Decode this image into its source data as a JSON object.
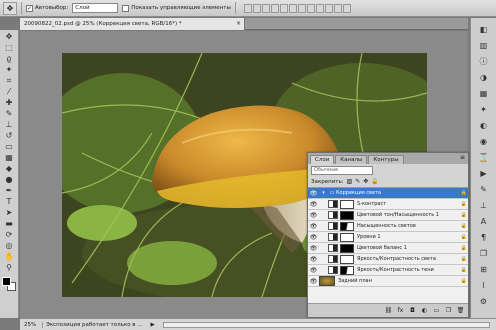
{
  "options_bar": {
    "autoselect_label": "Автовыбор:",
    "autoselect_checked": "✓",
    "autoselect_value": "Слой",
    "show_controls_label": "Показать управляющие элементы",
    "show_controls_checked": ""
  },
  "document": {
    "tab_title": "20090822_02.psd @ 25% (Коррекция света, RGB/16*) *",
    "close_glyph": "×"
  },
  "status_bar": {
    "zoom": "25%",
    "info": "Экспозиция работает только в ...",
    "arrow": "▶"
  },
  "layers_panel": {
    "tabs": [
      "Слои",
      "Каналы",
      "Контуры"
    ],
    "active_tab": "Слои",
    "blend_mode": "Обычные",
    "lock_label": "Закрепить:",
    "menu_glyph": "≡",
    "layers": [
      {
        "name": "Коррекция света",
        "type": "group",
        "selected": true
      },
      {
        "name": "S-контраст",
        "type": "adjustment",
        "mask": "white"
      },
      {
        "name": "Цветовой тон/Насыщенность 1",
        "type": "adjustment",
        "mask": "black"
      },
      {
        "name": "Насыщенность светов",
        "type": "adjustment",
        "mask": "mixed"
      },
      {
        "name": "Уровни 1",
        "type": "adjustment",
        "mask": "white"
      },
      {
        "name": "Цветовой баланс 1",
        "type": "adjustment",
        "mask": "black"
      },
      {
        "name": "Яркость/Контрастность света",
        "type": "adjustment",
        "mask": "white"
      },
      {
        "name": "Яркость/Контрастность тени",
        "type": "adjustment",
        "mask": "mixed"
      },
      {
        "name": "Задний план",
        "type": "background"
      }
    ]
  },
  "colors": {
    "selected_layer": "#3a78c8",
    "foreground": "#000000",
    "background": "#ffffff"
  }
}
